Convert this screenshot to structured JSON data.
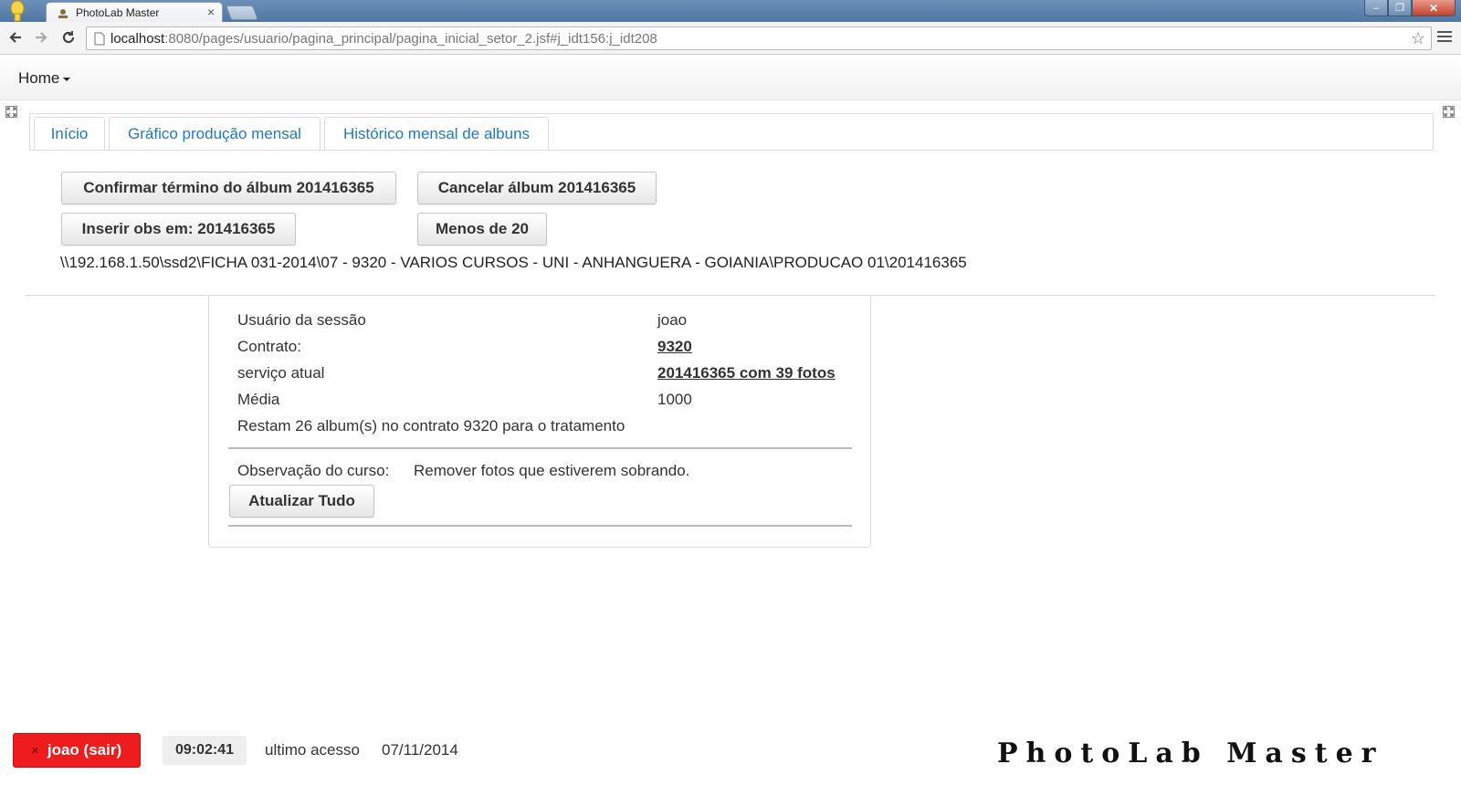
{
  "browser": {
    "tab_title": "PhotoLab Master",
    "url_host": "localhost",
    "url_path": ":8080/pages/usuario/pagina_principal/pagina_inicial_setor_2.jsf#j_idt156:j_idt208"
  },
  "appbar": {
    "home_label": "Home"
  },
  "tabs": [
    {
      "label": "Início"
    },
    {
      "label": "Gráfico produção mensal"
    },
    {
      "label": "Histórico mensal de albuns"
    }
  ],
  "actions": {
    "confirm_label": "Confirmar término do álbum 201416365",
    "cancel_label": "Cancelar álbum 201416365",
    "insert_obs_label": "Inserir obs em: 201416365",
    "less_than_20_label": "Menos de 20"
  },
  "path": "\\\\192.168.1.50\\ssd2\\FICHA 031-2014\\07 - 9320 - VARIOS CURSOS - UNI - ANHANGUERA - GOIANIA\\PRODUCAO 01\\201416365",
  "info": {
    "session_user_label": "Usuário da sessão",
    "session_user_value": "joao",
    "contract_label": "Contrato:",
    "contract_value": "9320",
    "service_label": "serviço atual",
    "service_value": "201416365 com 39 fotos",
    "average_label": "Média",
    "average_value": "1000",
    "remaining_text": "Restam 26 album(s) no contrato 9320 para o tratamento",
    "course_obs_label": "Observação do curso:",
    "course_obs_value": "Remover fotos que estiverem sobrando.",
    "update_all_label": "Atualizar Tudo"
  },
  "footer": {
    "user_button_label": "joao (sair)",
    "clock": "09:02:41",
    "last_access_label": "ultimo acesso",
    "last_access_date": "07/11/2014",
    "brand": "PhotoLab Master"
  },
  "colors": {
    "accent_link": "#1f7ac1",
    "logout_red": "#ee1c1c"
  },
  "icons": {
    "back": "back-arrow-icon",
    "forward": "forward-arrow-icon",
    "reload": "reload-icon",
    "bookmark": "star-icon",
    "menu": "hamburger-menu-icon",
    "expand": "expand-icon",
    "logout": "close-x-icon"
  }
}
